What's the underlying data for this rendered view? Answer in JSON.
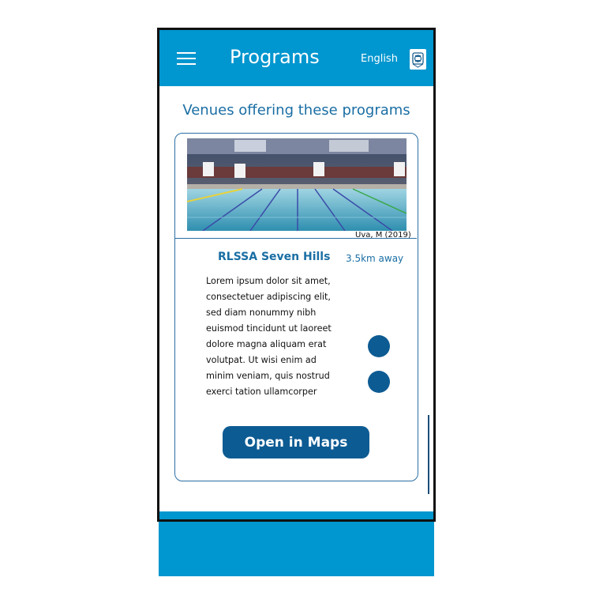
{
  "header": {
    "title": "Programs",
    "language": "English",
    "menu_icon": "hamburger-icon",
    "crest_icon": "crest-logo-icon"
  },
  "section": {
    "title": "Venues offering these programs"
  },
  "venue": {
    "image_credit": "Uva, M (2019)",
    "name": "RLSSA Seven Hills",
    "distance": "3.5km away",
    "description": "Lorem ipsum dolor sit amet, consectetuer adipiscing elit, sed diam nonummy nibh euismod tincidunt ut laoreet dolore magna aliquam erat volutpat. Ut wisi enim ad minim veniam, quis nostrud exerci tation ullamcorper",
    "maps_button": "Open in Maps"
  },
  "colors": {
    "primary": "#0096cf",
    "accent": "#0d5b93",
    "text_blue": "#1a6ea4"
  }
}
